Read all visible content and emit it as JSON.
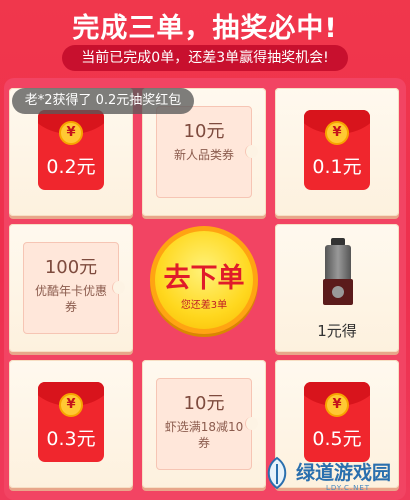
{
  "header": {
    "title": "完成三单，抽奖必中!",
    "subtitle": "当前已完成0单，还差3单赢得抽奖机会!"
  },
  "toast": "老*2获得了 0.2元抽奖红包",
  "prizes": {
    "tl": {
      "amount": "0.2元"
    },
    "tc": {
      "amount": "10元",
      "desc": "新人品类券"
    },
    "tr": {
      "amount": "0.1元"
    },
    "ml": {
      "amount": "100元",
      "desc": "优酷年卡优惠券"
    },
    "mr": {
      "label": "1元得"
    },
    "bl": {
      "amount": "0.3元"
    },
    "bc": {
      "amount": "10元",
      "desc": "虾选满18减10券"
    },
    "br": {
      "amount": "0.5元"
    }
  },
  "go_button": {
    "label": "去下单",
    "sub": "您还差3单"
  },
  "coin_symbol": "¥",
  "watermark": {
    "text": "绿道游戏园",
    "sub": "LDY.C.NET"
  },
  "colors": {
    "accent": "#f0374c",
    "packet": "#f0262d",
    "go_button": "#ffd81f"
  }
}
